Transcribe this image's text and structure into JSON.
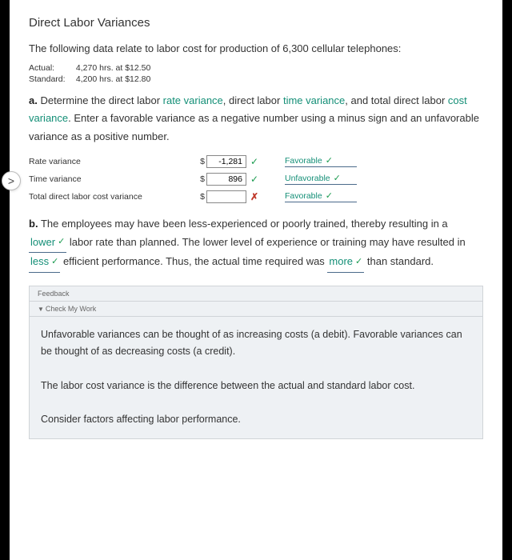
{
  "title": "Direct Labor Variances",
  "intro": "The following data relate to labor cost for production of 6,300 cellular telephones:",
  "data": {
    "actual_label": "Actual:",
    "actual_value": "4,270 hrs. at $12.50",
    "standard_label": "Standard:",
    "standard_value": "4,200 hrs. at $12.80"
  },
  "partA": {
    "prefix": "a.",
    "text1": "  Determine the direct labor ",
    "kw1": "rate variance",
    "text2": ", direct labor ",
    "kw2": "time variance",
    "text3": ", and total direct labor ",
    "kw3": "cost variance",
    "text4": ". Enter a favorable variance as a negative number using a minus sign and an unfavorable variance as a positive number."
  },
  "rows": {
    "r1": {
      "label": "Rate variance",
      "value": "-1,281",
      "mark": "✓",
      "markClass": "ok",
      "fav": "Favorable"
    },
    "r2": {
      "label": "Time variance",
      "value": "896",
      "mark": "✓",
      "markClass": "ok",
      "fav": "Unfavorable"
    },
    "r3": {
      "label": "Total direct labor cost variance",
      "value": "",
      "mark": "✗",
      "markClass": "bad",
      "fav": "Favorable"
    }
  },
  "partB": {
    "prefix": "b.",
    "t1": "  The employees may have been less-experienced or poorly trained, thereby resulting in a ",
    "f1": "lower",
    "t2": " labor rate than planned. The lower level of experience or training may have resulted in ",
    "f2": "less",
    "t3": " efficient performance. Thus, the actual time required was ",
    "f3": "more",
    "t4": " than standard."
  },
  "feedback": {
    "header": "Feedback",
    "check": "Check My Work",
    "p1": "Unfavorable variances can be thought of as increasing costs (a debit). Favorable variances can be thought of as decreasing costs (a credit).",
    "p2": "The labor cost variance is the difference between the actual and standard labor cost.",
    "p3": "Consider factors affecting labor performance."
  },
  "nav": {
    "next": ">"
  },
  "checkmark": "✓",
  "tri": "▼"
}
